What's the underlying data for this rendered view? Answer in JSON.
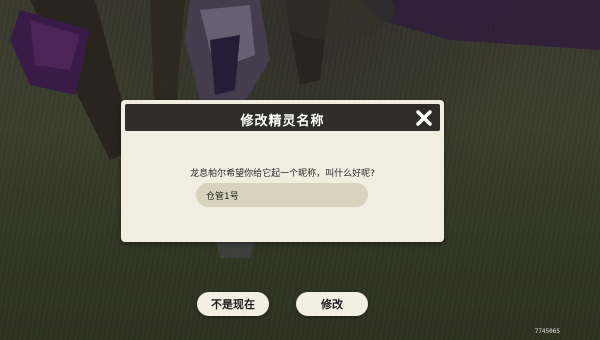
{
  "dialog": {
    "title": "修改精灵名称",
    "prompt": "龙息帕尔希望你给它起一个昵称，叫什么好呢?",
    "input_value": "仓管1号",
    "close_icon": "close-icon"
  },
  "buttons": {
    "later_label": "不是现在",
    "confirm_label": "修改"
  },
  "uid": "7745065",
  "colors": {
    "dialog_bg": "#f1ede0",
    "header_bg": "#2e2d29",
    "input_bg": "#d9d3bd",
    "button_bg": "#f2efe3"
  }
}
